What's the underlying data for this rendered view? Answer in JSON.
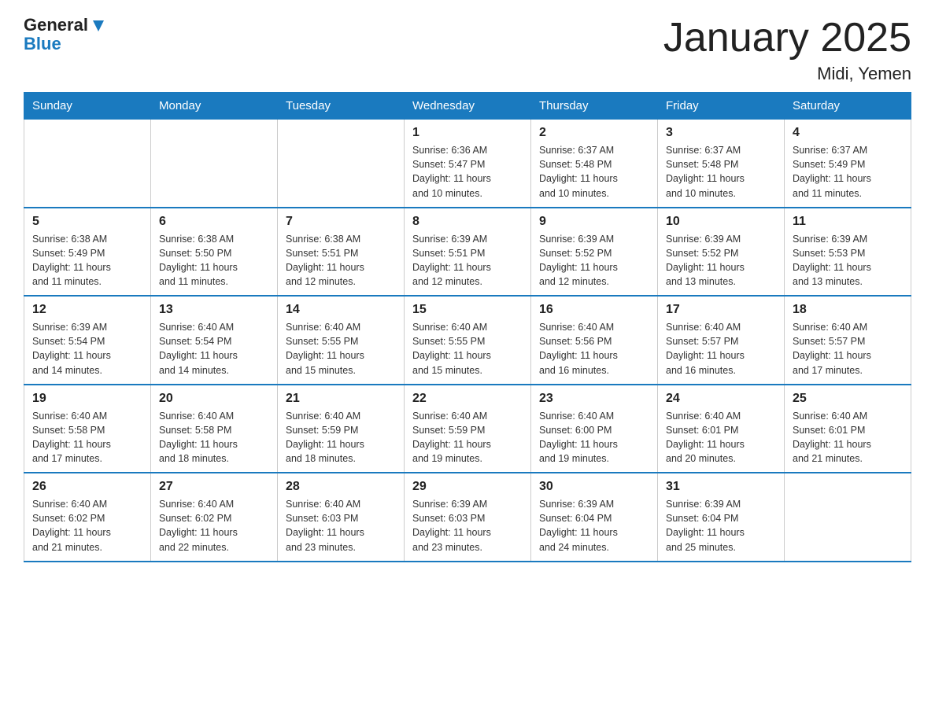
{
  "header": {
    "logo_line1": "General",
    "logo_line2": "Blue",
    "title": "January 2025",
    "subtitle": "Midi, Yemen"
  },
  "days_of_week": [
    "Sunday",
    "Monday",
    "Tuesday",
    "Wednesday",
    "Thursday",
    "Friday",
    "Saturday"
  ],
  "weeks": [
    [
      {
        "day": "",
        "info": ""
      },
      {
        "day": "",
        "info": ""
      },
      {
        "day": "",
        "info": ""
      },
      {
        "day": "1",
        "info": "Sunrise: 6:36 AM\nSunset: 5:47 PM\nDaylight: 11 hours\nand 10 minutes."
      },
      {
        "day": "2",
        "info": "Sunrise: 6:37 AM\nSunset: 5:48 PM\nDaylight: 11 hours\nand 10 minutes."
      },
      {
        "day": "3",
        "info": "Sunrise: 6:37 AM\nSunset: 5:48 PM\nDaylight: 11 hours\nand 10 minutes."
      },
      {
        "day": "4",
        "info": "Sunrise: 6:37 AM\nSunset: 5:49 PM\nDaylight: 11 hours\nand 11 minutes."
      }
    ],
    [
      {
        "day": "5",
        "info": "Sunrise: 6:38 AM\nSunset: 5:49 PM\nDaylight: 11 hours\nand 11 minutes."
      },
      {
        "day": "6",
        "info": "Sunrise: 6:38 AM\nSunset: 5:50 PM\nDaylight: 11 hours\nand 11 minutes."
      },
      {
        "day": "7",
        "info": "Sunrise: 6:38 AM\nSunset: 5:51 PM\nDaylight: 11 hours\nand 12 minutes."
      },
      {
        "day": "8",
        "info": "Sunrise: 6:39 AM\nSunset: 5:51 PM\nDaylight: 11 hours\nand 12 minutes."
      },
      {
        "day": "9",
        "info": "Sunrise: 6:39 AM\nSunset: 5:52 PM\nDaylight: 11 hours\nand 12 minutes."
      },
      {
        "day": "10",
        "info": "Sunrise: 6:39 AM\nSunset: 5:52 PM\nDaylight: 11 hours\nand 13 minutes."
      },
      {
        "day": "11",
        "info": "Sunrise: 6:39 AM\nSunset: 5:53 PM\nDaylight: 11 hours\nand 13 minutes."
      }
    ],
    [
      {
        "day": "12",
        "info": "Sunrise: 6:39 AM\nSunset: 5:54 PM\nDaylight: 11 hours\nand 14 minutes."
      },
      {
        "day": "13",
        "info": "Sunrise: 6:40 AM\nSunset: 5:54 PM\nDaylight: 11 hours\nand 14 minutes."
      },
      {
        "day": "14",
        "info": "Sunrise: 6:40 AM\nSunset: 5:55 PM\nDaylight: 11 hours\nand 15 minutes."
      },
      {
        "day": "15",
        "info": "Sunrise: 6:40 AM\nSunset: 5:55 PM\nDaylight: 11 hours\nand 15 minutes."
      },
      {
        "day": "16",
        "info": "Sunrise: 6:40 AM\nSunset: 5:56 PM\nDaylight: 11 hours\nand 16 minutes."
      },
      {
        "day": "17",
        "info": "Sunrise: 6:40 AM\nSunset: 5:57 PM\nDaylight: 11 hours\nand 16 minutes."
      },
      {
        "day": "18",
        "info": "Sunrise: 6:40 AM\nSunset: 5:57 PM\nDaylight: 11 hours\nand 17 minutes."
      }
    ],
    [
      {
        "day": "19",
        "info": "Sunrise: 6:40 AM\nSunset: 5:58 PM\nDaylight: 11 hours\nand 17 minutes."
      },
      {
        "day": "20",
        "info": "Sunrise: 6:40 AM\nSunset: 5:58 PM\nDaylight: 11 hours\nand 18 minutes."
      },
      {
        "day": "21",
        "info": "Sunrise: 6:40 AM\nSunset: 5:59 PM\nDaylight: 11 hours\nand 18 minutes."
      },
      {
        "day": "22",
        "info": "Sunrise: 6:40 AM\nSunset: 5:59 PM\nDaylight: 11 hours\nand 19 minutes."
      },
      {
        "day": "23",
        "info": "Sunrise: 6:40 AM\nSunset: 6:00 PM\nDaylight: 11 hours\nand 19 minutes."
      },
      {
        "day": "24",
        "info": "Sunrise: 6:40 AM\nSunset: 6:01 PM\nDaylight: 11 hours\nand 20 minutes."
      },
      {
        "day": "25",
        "info": "Sunrise: 6:40 AM\nSunset: 6:01 PM\nDaylight: 11 hours\nand 21 minutes."
      }
    ],
    [
      {
        "day": "26",
        "info": "Sunrise: 6:40 AM\nSunset: 6:02 PM\nDaylight: 11 hours\nand 21 minutes."
      },
      {
        "day": "27",
        "info": "Sunrise: 6:40 AM\nSunset: 6:02 PM\nDaylight: 11 hours\nand 22 minutes."
      },
      {
        "day": "28",
        "info": "Sunrise: 6:40 AM\nSunset: 6:03 PM\nDaylight: 11 hours\nand 23 minutes."
      },
      {
        "day": "29",
        "info": "Sunrise: 6:39 AM\nSunset: 6:03 PM\nDaylight: 11 hours\nand 23 minutes."
      },
      {
        "day": "30",
        "info": "Sunrise: 6:39 AM\nSunset: 6:04 PM\nDaylight: 11 hours\nand 24 minutes."
      },
      {
        "day": "31",
        "info": "Sunrise: 6:39 AM\nSunset: 6:04 PM\nDaylight: 11 hours\nand 25 minutes."
      },
      {
        "day": "",
        "info": ""
      }
    ]
  ]
}
